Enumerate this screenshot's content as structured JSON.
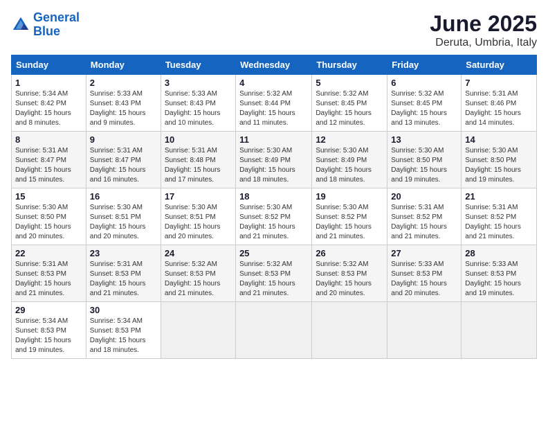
{
  "logo": {
    "line1": "General",
    "line2": "Blue"
  },
  "title": "June 2025",
  "subtitle": "Deruta, Umbria, Italy",
  "days_header": [
    "Sunday",
    "Monday",
    "Tuesday",
    "Wednesday",
    "Thursday",
    "Friday",
    "Saturday"
  ],
  "weeks": [
    [
      {
        "day": "1",
        "sunrise": "Sunrise: 5:34 AM",
        "sunset": "Sunset: 8:42 PM",
        "daylight": "Daylight: 15 hours and 8 minutes."
      },
      {
        "day": "2",
        "sunrise": "Sunrise: 5:33 AM",
        "sunset": "Sunset: 8:43 PM",
        "daylight": "Daylight: 15 hours and 9 minutes."
      },
      {
        "day": "3",
        "sunrise": "Sunrise: 5:33 AM",
        "sunset": "Sunset: 8:43 PM",
        "daylight": "Daylight: 15 hours and 10 minutes."
      },
      {
        "day": "4",
        "sunrise": "Sunrise: 5:32 AM",
        "sunset": "Sunset: 8:44 PM",
        "daylight": "Daylight: 15 hours and 11 minutes."
      },
      {
        "day": "5",
        "sunrise": "Sunrise: 5:32 AM",
        "sunset": "Sunset: 8:45 PM",
        "daylight": "Daylight: 15 hours and 12 minutes."
      },
      {
        "day": "6",
        "sunrise": "Sunrise: 5:32 AM",
        "sunset": "Sunset: 8:45 PM",
        "daylight": "Daylight: 15 hours and 13 minutes."
      },
      {
        "day": "7",
        "sunrise": "Sunrise: 5:31 AM",
        "sunset": "Sunset: 8:46 PM",
        "daylight": "Daylight: 15 hours and 14 minutes."
      }
    ],
    [
      {
        "day": "8",
        "sunrise": "Sunrise: 5:31 AM",
        "sunset": "Sunset: 8:47 PM",
        "daylight": "Daylight: 15 hours and 15 minutes."
      },
      {
        "day": "9",
        "sunrise": "Sunrise: 5:31 AM",
        "sunset": "Sunset: 8:47 PM",
        "daylight": "Daylight: 15 hours and 16 minutes."
      },
      {
        "day": "10",
        "sunrise": "Sunrise: 5:31 AM",
        "sunset": "Sunset: 8:48 PM",
        "daylight": "Daylight: 15 hours and 17 minutes."
      },
      {
        "day": "11",
        "sunrise": "Sunrise: 5:30 AM",
        "sunset": "Sunset: 8:49 PM",
        "daylight": "Daylight: 15 hours and 18 minutes."
      },
      {
        "day": "12",
        "sunrise": "Sunrise: 5:30 AM",
        "sunset": "Sunset: 8:49 PM",
        "daylight": "Daylight: 15 hours and 18 minutes."
      },
      {
        "day": "13",
        "sunrise": "Sunrise: 5:30 AM",
        "sunset": "Sunset: 8:50 PM",
        "daylight": "Daylight: 15 hours and 19 minutes."
      },
      {
        "day": "14",
        "sunrise": "Sunrise: 5:30 AM",
        "sunset": "Sunset: 8:50 PM",
        "daylight": "Daylight: 15 hours and 19 minutes."
      }
    ],
    [
      {
        "day": "15",
        "sunrise": "Sunrise: 5:30 AM",
        "sunset": "Sunset: 8:50 PM",
        "daylight": "Daylight: 15 hours and 20 minutes."
      },
      {
        "day": "16",
        "sunrise": "Sunrise: 5:30 AM",
        "sunset": "Sunset: 8:51 PM",
        "daylight": "Daylight: 15 hours and 20 minutes."
      },
      {
        "day": "17",
        "sunrise": "Sunrise: 5:30 AM",
        "sunset": "Sunset: 8:51 PM",
        "daylight": "Daylight: 15 hours and 20 minutes."
      },
      {
        "day": "18",
        "sunrise": "Sunrise: 5:30 AM",
        "sunset": "Sunset: 8:52 PM",
        "daylight": "Daylight: 15 hours and 21 minutes."
      },
      {
        "day": "19",
        "sunrise": "Sunrise: 5:30 AM",
        "sunset": "Sunset: 8:52 PM",
        "daylight": "Daylight: 15 hours and 21 minutes."
      },
      {
        "day": "20",
        "sunrise": "Sunrise: 5:31 AM",
        "sunset": "Sunset: 8:52 PM",
        "daylight": "Daylight: 15 hours and 21 minutes."
      },
      {
        "day": "21",
        "sunrise": "Sunrise: 5:31 AM",
        "sunset": "Sunset: 8:52 PM",
        "daylight": "Daylight: 15 hours and 21 minutes."
      }
    ],
    [
      {
        "day": "22",
        "sunrise": "Sunrise: 5:31 AM",
        "sunset": "Sunset: 8:53 PM",
        "daylight": "Daylight: 15 hours and 21 minutes."
      },
      {
        "day": "23",
        "sunrise": "Sunrise: 5:31 AM",
        "sunset": "Sunset: 8:53 PM",
        "daylight": "Daylight: 15 hours and 21 minutes."
      },
      {
        "day": "24",
        "sunrise": "Sunrise: 5:32 AM",
        "sunset": "Sunset: 8:53 PM",
        "daylight": "Daylight: 15 hours and 21 minutes."
      },
      {
        "day": "25",
        "sunrise": "Sunrise: 5:32 AM",
        "sunset": "Sunset: 8:53 PM",
        "daylight": "Daylight: 15 hours and 21 minutes."
      },
      {
        "day": "26",
        "sunrise": "Sunrise: 5:32 AM",
        "sunset": "Sunset: 8:53 PM",
        "daylight": "Daylight: 15 hours and 20 minutes."
      },
      {
        "day": "27",
        "sunrise": "Sunrise: 5:33 AM",
        "sunset": "Sunset: 8:53 PM",
        "daylight": "Daylight: 15 hours and 20 minutes."
      },
      {
        "day": "28",
        "sunrise": "Sunrise: 5:33 AM",
        "sunset": "Sunset: 8:53 PM",
        "daylight": "Daylight: 15 hours and 19 minutes."
      }
    ],
    [
      {
        "day": "29",
        "sunrise": "Sunrise: 5:34 AM",
        "sunset": "Sunset: 8:53 PM",
        "daylight": "Daylight: 15 hours and 19 minutes."
      },
      {
        "day": "30",
        "sunrise": "Sunrise: 5:34 AM",
        "sunset": "Sunset: 8:53 PM",
        "daylight": "Daylight: 15 hours and 18 minutes."
      },
      null,
      null,
      null,
      null,
      null
    ]
  ]
}
